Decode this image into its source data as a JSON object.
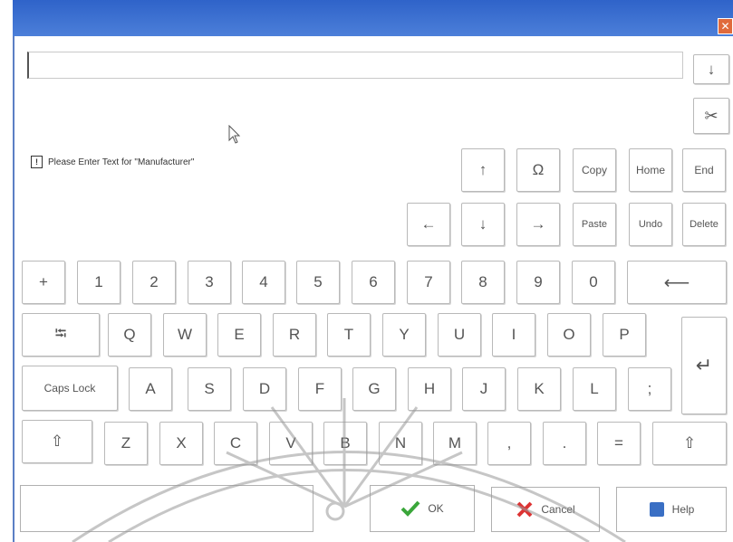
{
  "window": {
    "close_label": "✕"
  },
  "prompt": {
    "icon_glyph": "!",
    "text": "Please Enter Text for \"Manufacturer\""
  },
  "side_buttons": {
    "down_arrow": "↓",
    "settings_glyph": "✂"
  },
  "nav_keys": {
    "up": "↑",
    "omega": "Ω",
    "copy": "Copy",
    "home": "Home",
    "end": "End",
    "left": "←",
    "down": "↓",
    "right": "→",
    "paste": "Paste",
    "undo": "Undo",
    "delete": "Delete"
  },
  "number_row": [
    "+",
    "1",
    "2",
    "3",
    "4",
    "5",
    "6",
    "7",
    "8",
    "9",
    "0"
  ],
  "backspace": "⟵",
  "row_q": [
    "Q",
    "W",
    "E",
    "R",
    "T",
    "Y",
    "U",
    "I",
    "O",
    "P"
  ],
  "tab": "⭾",
  "enter": "↵",
  "row_a": [
    "A",
    "S",
    "D",
    "F",
    "G",
    "H",
    "J",
    "K",
    "L",
    ";"
  ],
  "caps_lock": "Caps Lock",
  "row_z": [
    "Z",
    "X",
    "C",
    "V",
    "B",
    "N",
    "M",
    ",",
    ".",
    "="
  ],
  "shift_left": "⇧",
  "shift_right": "⇧",
  "bottom": {
    "ok": "OK",
    "cancel": "Cancel",
    "help": "Help"
  },
  "colors": {
    "title_bar": "#2f63c9",
    "ok_check": "#3aa63a",
    "cancel_x": "#d33",
    "help_icon": "#3a6fc4"
  }
}
